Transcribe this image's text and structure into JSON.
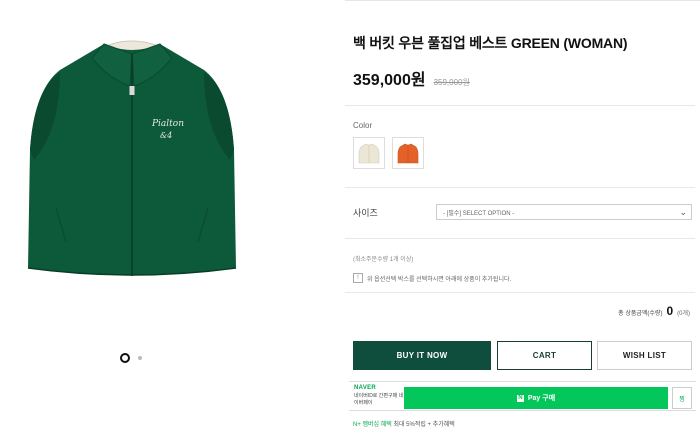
{
  "product": {
    "title": "백 버킷 우븐 풀집업 베스트 GREEN (WOMAN)",
    "price": "359,000원",
    "original_price": "359,000원",
    "image_icon": "green-zip-vest-image",
    "gallery": {
      "active_index": 0,
      "count": 2
    }
  },
  "options": {
    "color_label": "Color",
    "colors": [
      {
        "name": "ivory",
        "hex": "#ece6d6"
      },
      {
        "name": "orange",
        "hex": "#e4622a"
      }
    ],
    "size_label": "사이즈",
    "size_placeholder": "- [필수] SELECT OPTION -"
  },
  "order": {
    "min_quantity_note": "(최소주문수량 1개 이상)",
    "notice_text": "위 옵션선택 박스를 선택하시면 아래에 상품이 추가됩니다.",
    "total_label": "총 상품금액(수량)",
    "total_value": "0",
    "total_count": "(0개)"
  },
  "buttons": {
    "buy_now": "BUY IT NOW",
    "cart": "CART",
    "wish_list": "WISH LIST"
  },
  "naver_pay": {
    "logo": "NAVER",
    "description": "네이버ID로 간편구매 네이버페이",
    "button_label": "Pay 구매",
    "wish_label": "찜",
    "event_highlight": "N+ 멤버십 혜택",
    "event_text": "최대 5%적립 + 추가혜택"
  },
  "colors": {
    "brand_green": "#0f4d3c",
    "naver_green": "#03c75a"
  }
}
